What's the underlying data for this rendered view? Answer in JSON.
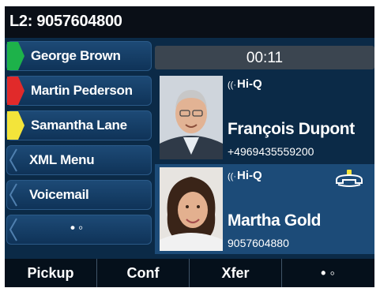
{
  "header": {
    "title": "L2: 9057604800"
  },
  "line_keys": [
    {
      "label": "George Brown",
      "indicator_color": "#1db24a"
    },
    {
      "label": "Martin Pederson",
      "indicator_color": "#e12a2a"
    },
    {
      "label": "Samantha Lane",
      "indicator_color": "#f3e43a"
    },
    {
      "label": "XML Menu"
    },
    {
      "label": "Voicemail"
    },
    {
      "label": "• ◦"
    }
  ],
  "call_timer": "00:11",
  "calls": [
    {
      "hiq": "Hi-Q",
      "name": "François Dupont",
      "number": "+4969435559200"
    },
    {
      "hiq": "Hi-Q",
      "name": "Martha Gold",
      "number": "9057604880",
      "status_icon": "hold-handset-icon"
    }
  ],
  "soft_keys": [
    "Pickup",
    "Conf",
    "Xfer",
    "• ◦"
  ],
  "colors": {
    "screen_bg": "#0b2a47",
    "header_bg": "#0a0f17",
    "active_call_bg": "#1c4b78",
    "timer_bg": "#3b4550",
    "hold_icon": "#f3e43a"
  }
}
